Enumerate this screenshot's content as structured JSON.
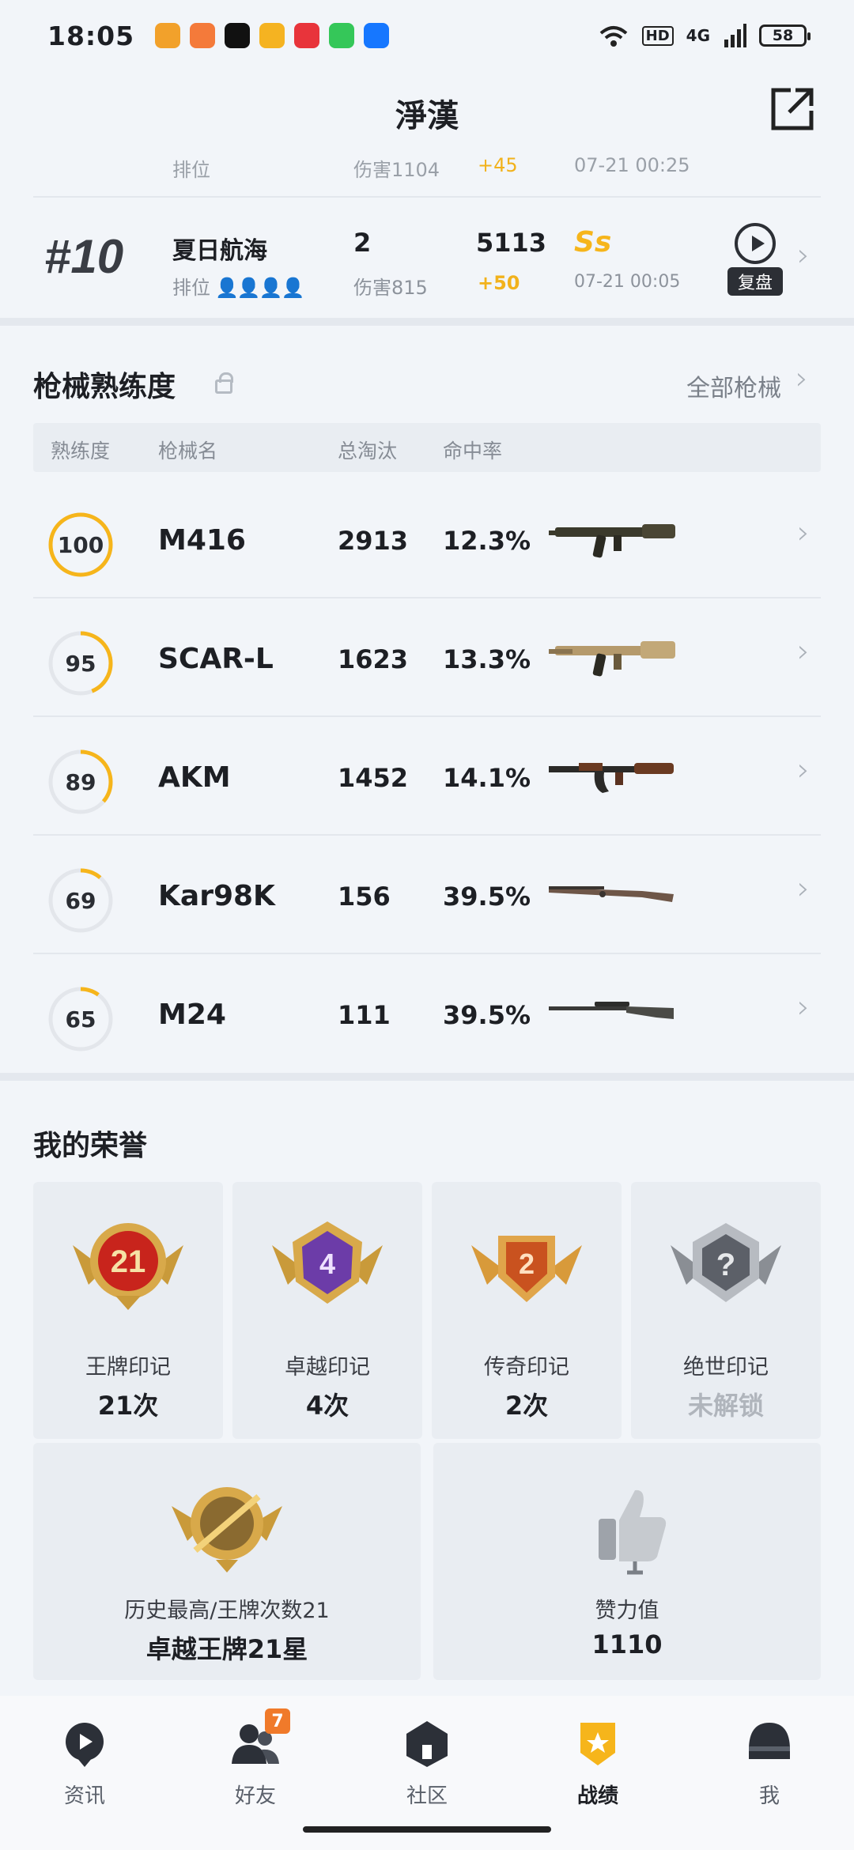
{
  "status_bar": {
    "time": "18:05",
    "network": "4G",
    "hd": "HD",
    "battery": "58"
  },
  "header": {
    "title": "淨漢"
  },
  "partial_match": {
    "mode": "排位",
    "damage": "伤害1104",
    "delta": "+45",
    "time": "07-21 00:25"
  },
  "match": {
    "rank": "#10",
    "map": "夏日航海",
    "mode": "排位",
    "kills": "2",
    "damage": "伤害815",
    "score": "5113",
    "delta": "+50",
    "grade": "Ss",
    "time": "07-21 00:05",
    "replay_label": "复盘"
  },
  "weapons": {
    "title": "枪械熟练度",
    "all_link": "全部枪械",
    "headers": {
      "proficiency": "熟练度",
      "name": "枪械名",
      "kills": "总淘汰",
      "hit_rate": "命中率"
    },
    "rows": [
      {
        "proficiency": "100",
        "name": "M416",
        "kills": "2913",
        "hit_rate": "12.3%"
      },
      {
        "proficiency": "95",
        "name": "SCAR-L",
        "kills": "1623",
        "hit_rate": "13.3%"
      },
      {
        "proficiency": "89",
        "name": "AKM",
        "kills": "1452",
        "hit_rate": "14.1%"
      },
      {
        "proficiency": "69",
        "name": "Kar98K",
        "kills": "156",
        "hit_rate": "39.5%"
      },
      {
        "proficiency": "65",
        "name": "M24",
        "kills": "111",
        "hit_rate": "39.5%"
      }
    ]
  },
  "honors": {
    "title": "我的荣誉",
    "marks": [
      {
        "badge": "21",
        "name": "王牌印记",
        "value": "21次"
      },
      {
        "badge": "4",
        "name": "卓越印记",
        "value": "4次"
      },
      {
        "badge": "2",
        "name": "传奇印记",
        "value": "2次"
      },
      {
        "badge": "?",
        "name": "绝世印记",
        "value": "未解锁"
      }
    ],
    "best": {
      "name": "历史最高/王牌次数21",
      "value": "卓越王牌21星"
    },
    "likes": {
      "name": "赞力值",
      "value": "1110"
    }
  },
  "nav": {
    "items": [
      {
        "label": "资讯"
      },
      {
        "label": "好友",
        "badge": "7"
      },
      {
        "label": "社区"
      },
      {
        "label": "战绩"
      },
      {
        "label": "我"
      }
    ]
  },
  "colors": {
    "accent": "#f6b51b",
    "background": "#f2f5f9",
    "card": "#e9edf2"
  }
}
